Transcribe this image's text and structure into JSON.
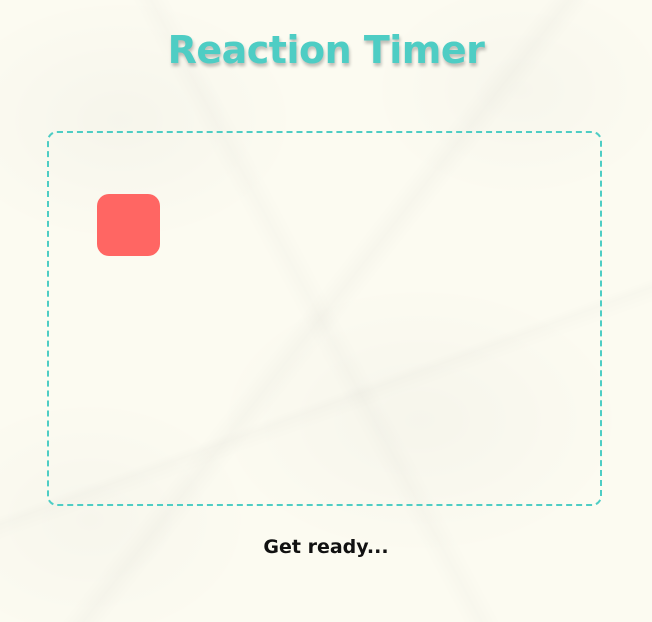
{
  "app": {
    "title": "Reaction Timer"
  },
  "game": {
    "target_shape": "rounded-square",
    "target_color": "#ff6663",
    "border_color": "#4ecdc4"
  },
  "status": {
    "text": "Get ready..."
  },
  "colors": {
    "accent": "#4ecdc4",
    "target": "#ff6663",
    "background": "#fcfbf1",
    "text": "#111111"
  }
}
